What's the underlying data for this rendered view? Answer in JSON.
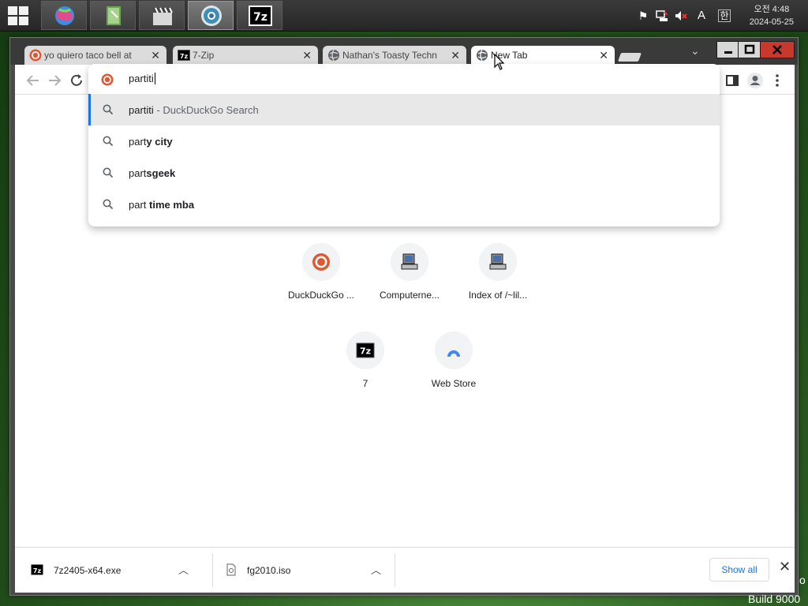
{
  "taskbar": {
    "apps": [
      {
        "name": "globe-app",
        "active": false
      },
      {
        "name": "book-app",
        "active": false
      },
      {
        "name": "clapper-app",
        "active": false
      },
      {
        "name": "chrome-app",
        "active": true
      },
      {
        "name": "7zip-app",
        "active": false
      }
    ],
    "clock": {
      "time": "오전 4:48",
      "date": "2024-05-25"
    },
    "tray": {
      "ime": "A",
      "lang": "한"
    }
  },
  "browser": {
    "tabs": [
      {
        "title": "yo quiero taco bell at",
        "favicon": "duckduckgo-icon",
        "active": false
      },
      {
        "title": "7-Zip",
        "favicon": "7zip-icon",
        "active": false
      },
      {
        "title": "Nathan's Toasty Techn",
        "favicon": "globe-icon",
        "active": false
      },
      {
        "title": "New Tab",
        "favicon": "globe-icon",
        "active": true
      }
    ],
    "omnibox": {
      "value": "partiti",
      "suggestions": [
        {
          "normal": "partiti",
          "bold": "",
          "suffix": " - DuckDuckGo Search",
          "selected": true
        },
        {
          "normal": "part",
          "bold": "y city",
          "suffix": "",
          "selected": false
        },
        {
          "normal": "part",
          "bold": "sgeek",
          "suffix": "",
          "selected": false
        },
        {
          "normal": "part ",
          "bold": "time mba",
          "suffix": "",
          "selected": false
        }
      ]
    },
    "shortcuts": [
      {
        "label": "DuckDuckGo ...",
        "icon": "duckduckgo-icon"
      },
      {
        "label": "Computerne...",
        "icon": "computer-icon"
      },
      {
        "label": "Index of /~lil...",
        "icon": "computer-icon"
      },
      {
        "label": "7",
        "icon": "7zip-icon"
      },
      {
        "label": "Web Store",
        "icon": "webstore-icon"
      }
    ]
  },
  "downloads": {
    "items": [
      {
        "name": "7z2405-x64.exe",
        "icon": "7zip-icon"
      },
      {
        "name": "fg2010.iso",
        "icon": "file-icon"
      }
    ],
    "show_all": "Show all"
  },
  "desktop": {
    "build_text": "Build 9000",
    "partial_text": "o"
  },
  "colors": {
    "accent": "#1a73e8",
    "close": "#c7392c",
    "duckduckgo": "#de5833"
  }
}
